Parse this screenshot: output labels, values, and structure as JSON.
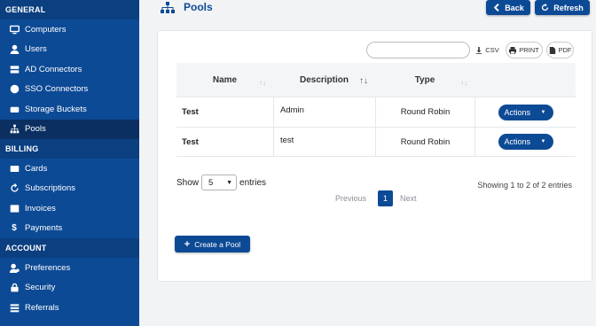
{
  "sidebar": {
    "sections": [
      {
        "title": "GENERAL"
      },
      {
        "title": "BILLING"
      },
      {
        "title": "ACCOUNT"
      }
    ],
    "general_items": [
      {
        "label": "Computers",
        "icon": "monitor-icon"
      },
      {
        "label": "Users",
        "icon": "user-icon"
      },
      {
        "label": "AD Connectors",
        "icon": "server-icon"
      },
      {
        "label": "SSO Connectors",
        "icon": "globe-icon"
      },
      {
        "label": "Storage Buckets",
        "icon": "storage-icon"
      },
      {
        "label": "Pools",
        "icon": "sitemap-icon",
        "active": true
      }
    ],
    "billing_items": [
      {
        "label": "Cards",
        "icon": "card-icon"
      },
      {
        "label": "Subscriptions",
        "icon": "refresh-icon"
      },
      {
        "label": "Invoices",
        "icon": "list-icon"
      },
      {
        "label": "Payments",
        "icon": "dollar-icon"
      }
    ],
    "account_items": [
      {
        "label": "Preferences",
        "icon": "user-cog-icon"
      },
      {
        "label": "Security",
        "icon": "lock-icon"
      },
      {
        "label": "Referrals",
        "icon": "list-icon"
      }
    ]
  },
  "header": {
    "title": "Pools",
    "back_label": "Back",
    "refresh_label": "Refresh"
  },
  "toolbar": {
    "search_value": "",
    "csv_label": "CSV",
    "print_label": "PRINT",
    "pdf_label": "PDF"
  },
  "table": {
    "columns": [
      "Name",
      "Description",
      "Type",
      ""
    ],
    "sort_glyphs": [
      "↑↓",
      "↑↓",
      "↑↓"
    ],
    "rows": [
      {
        "name": "Test",
        "description": "Admin",
        "type": "Round Robin",
        "action": "Actions"
      },
      {
        "name": "Test",
        "description": "test",
        "type": "Round Robin",
        "action": "Actions"
      }
    ]
  },
  "pagination": {
    "show_label": "Show",
    "entries_value": "5",
    "entries_label": "entries",
    "info": "Showing 1 to 2 of 2 entries",
    "previous": "Previous",
    "current_page": "1",
    "next": "Next"
  },
  "create_button": {
    "label": "Create a Pool"
  },
  "colors": {
    "brand": "#0d4a95",
    "sidebar_active": "#0a2f60"
  }
}
